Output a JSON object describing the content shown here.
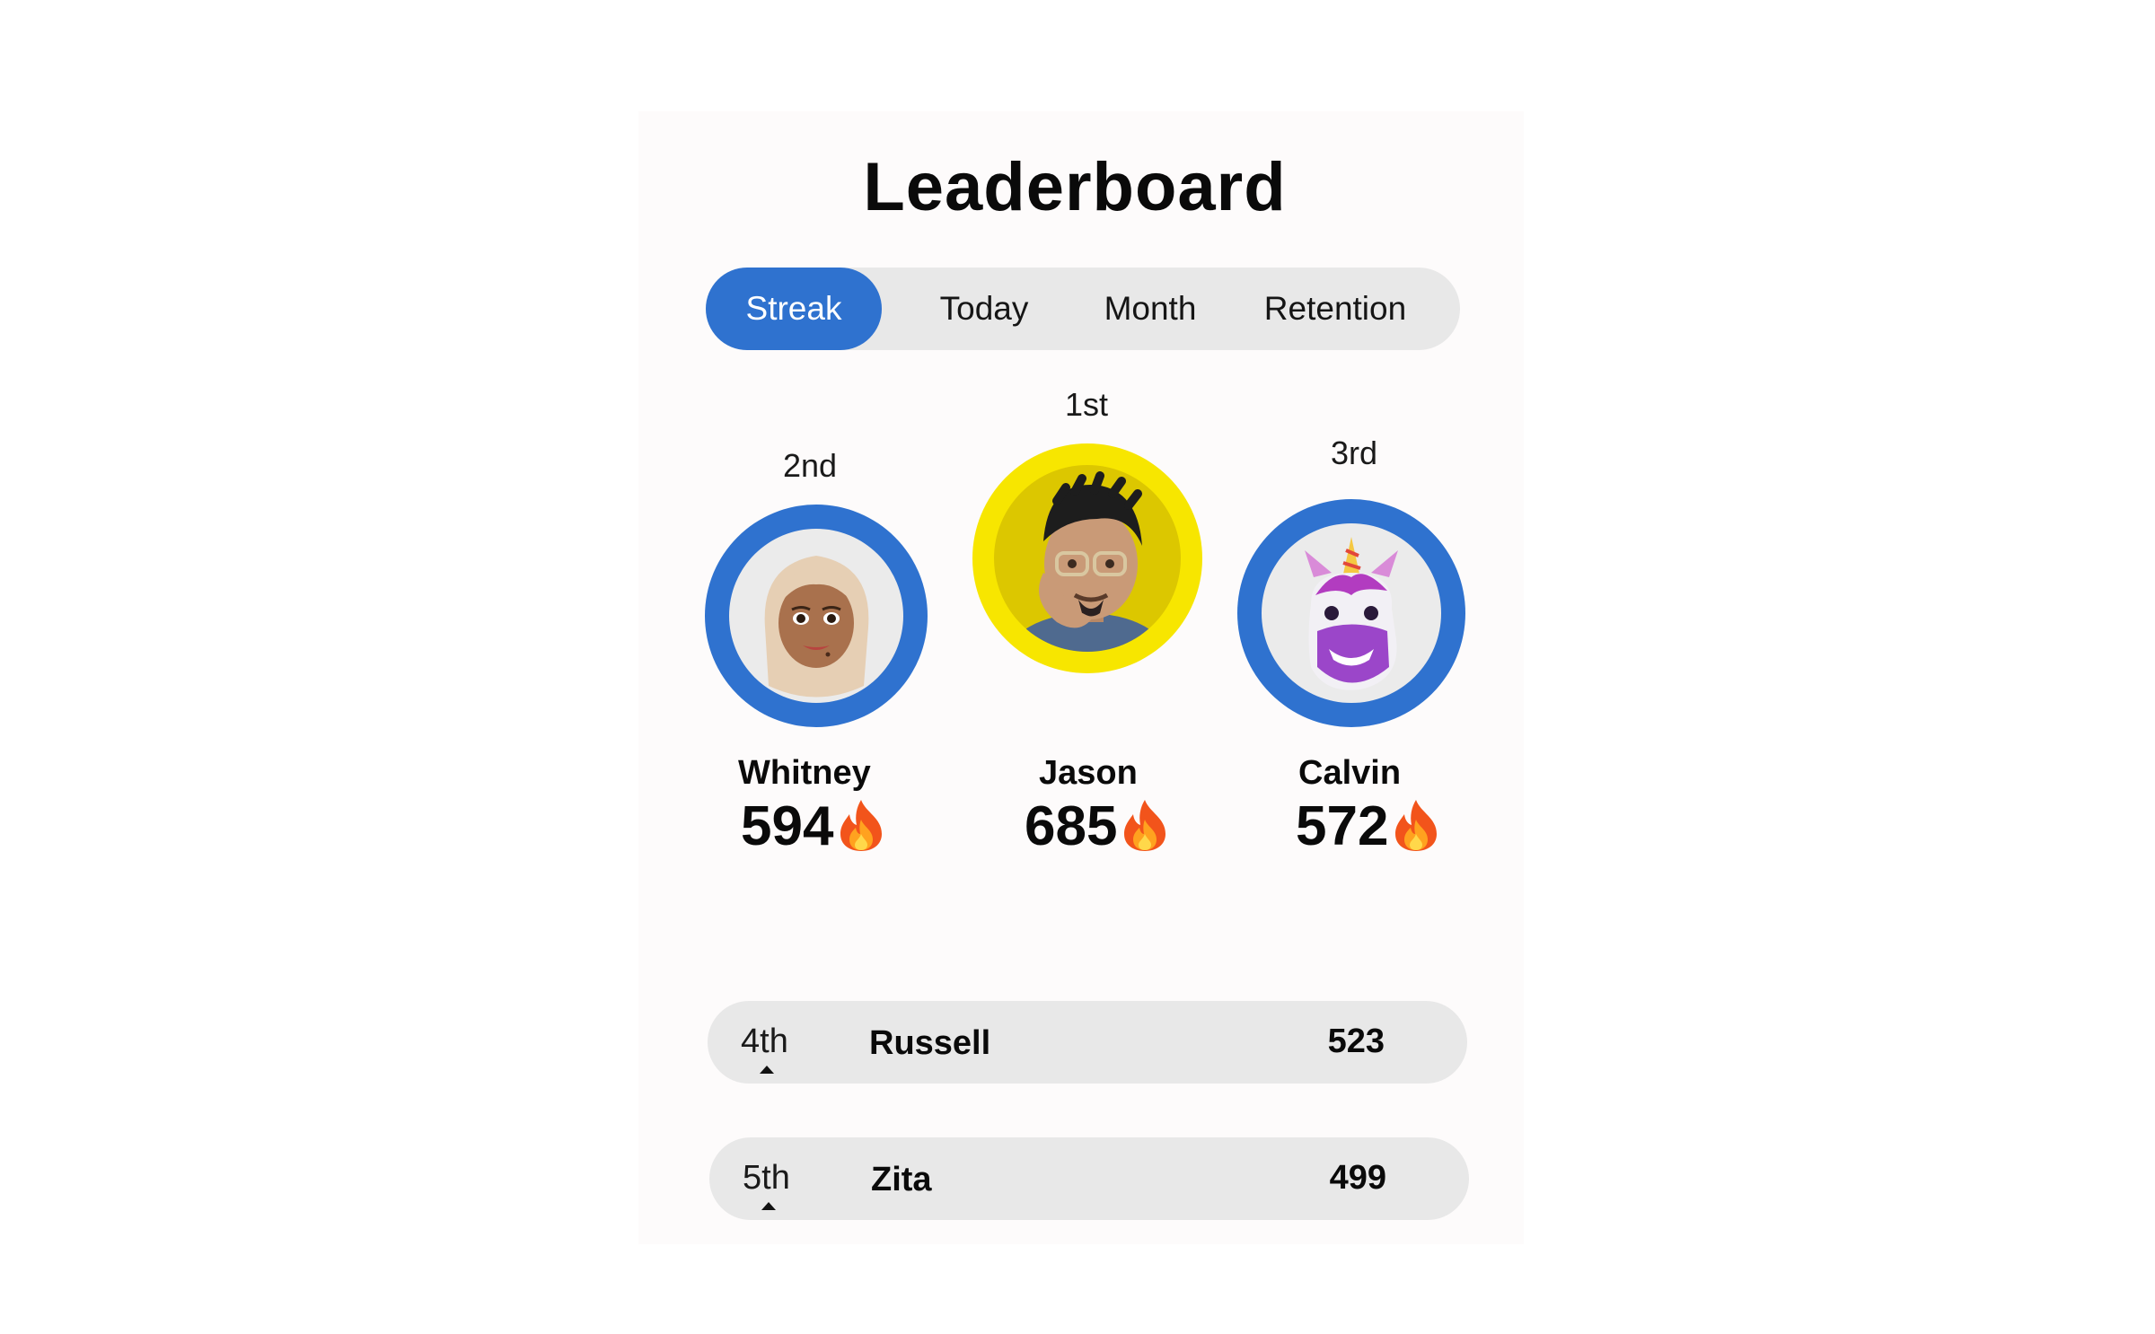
{
  "title": "Leaderboard",
  "tabs": [
    {
      "label": "Streak",
      "active": true
    },
    {
      "label": "Today",
      "active": false
    },
    {
      "label": "Month",
      "active": false
    },
    {
      "label": "Retention",
      "active": false
    }
  ],
  "podium": {
    "first": {
      "rank": "1st",
      "name": "Jason",
      "score": "685",
      "ring_color": "#f7e600",
      "avatar": "memoji-man-icon"
    },
    "second": {
      "rank": "2nd",
      "name": "Whitney",
      "score": "594",
      "ring_color": "#2f72cf",
      "avatar": "memoji-woman-hijab-icon"
    },
    "third": {
      "rank": "3rd",
      "name": "Calvin",
      "score": "572",
      "ring_color": "#2f72cf",
      "avatar": "unicorn-memoji-icon"
    }
  },
  "score_icon": "fire-icon",
  "list": [
    {
      "rank": "4th",
      "name": "Russell",
      "score": "523",
      "trend": "up-arrow-icon"
    },
    {
      "rank": "5th",
      "name": "Zita",
      "score": "499",
      "trend": "up-arrow-icon"
    }
  ],
  "colors": {
    "accent": "#2f72cf",
    "gold": "#f7e600",
    "pill_bg": "#e8e8e8"
  }
}
